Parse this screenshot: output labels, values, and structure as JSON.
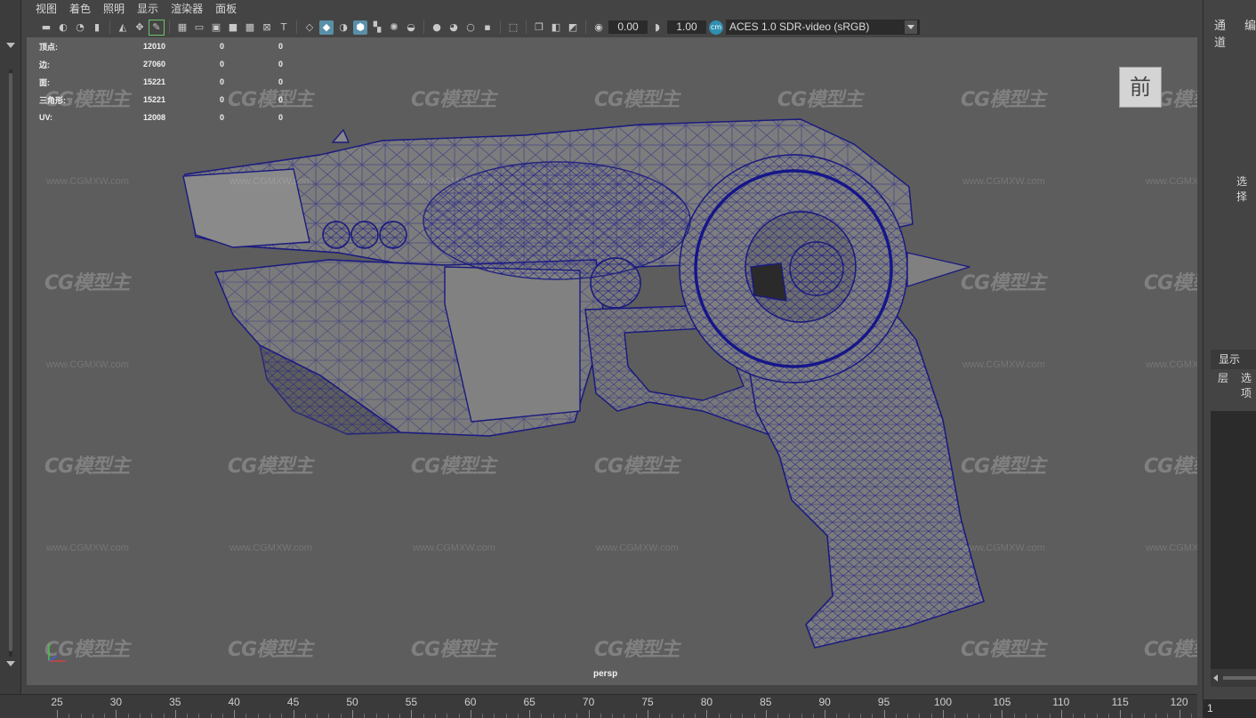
{
  "menubar": {
    "items": [
      "视图",
      "着色",
      "照明",
      "显示",
      "渲染器",
      "面板"
    ]
  },
  "toolbar": {
    "exposure_value": "0.00",
    "gamma_value": "1.00",
    "colorspace_label": "ACES 1.0 SDR-video (sRGB)",
    "icons": [
      "camera-icon",
      "camera-lock-icon",
      "bookmark-icon",
      "grid-icon",
      "wireframe-icon",
      "smooth-shade-icon",
      "lights-icon",
      "isolate-icon",
      "xray-icon",
      "color-management-icon"
    ]
  },
  "hud": {
    "rows": [
      {
        "label": "顶点:",
        "v1": "12010",
        "v2": "0",
        "v3": "0"
      },
      {
        "label": "边:",
        "v1": "27060",
        "v2": "0",
        "v3": "0"
      },
      {
        "label": "面:",
        "v1": "15221",
        "v2": "0",
        "v3": "0"
      },
      {
        "label": "三角形:",
        "v1": "15221",
        "v2": "0",
        "v3": "0"
      },
      {
        "label": "UV:",
        "v1": "12008",
        "v2": "0",
        "v3": "0"
      }
    ]
  },
  "viewcube": {
    "label": "前"
  },
  "camera": {
    "label": "persp"
  },
  "watermark": {
    "logo": "CG模型主",
    "url": "www.CGMXW.com"
  },
  "timeline": {
    "ticks": [
      "25",
      "30",
      "35",
      "40",
      "45",
      "50",
      "55",
      "60",
      "65",
      "70",
      "75",
      "80",
      "85",
      "90",
      "95",
      "100",
      "105",
      "110",
      "115",
      "120"
    ]
  },
  "right_panel": {
    "tabs": [
      "通道",
      "编"
    ],
    "select_label": "选择",
    "layer_tab": "显示",
    "layer_sub": [
      "层",
      "选项"
    ],
    "current_frame": "1"
  },
  "colors": {
    "wire": "#1a1a8a",
    "mesh": "#7b7b7b",
    "viewport_bg": "#5d5d5d",
    "accent": "#5a8fa8"
  }
}
